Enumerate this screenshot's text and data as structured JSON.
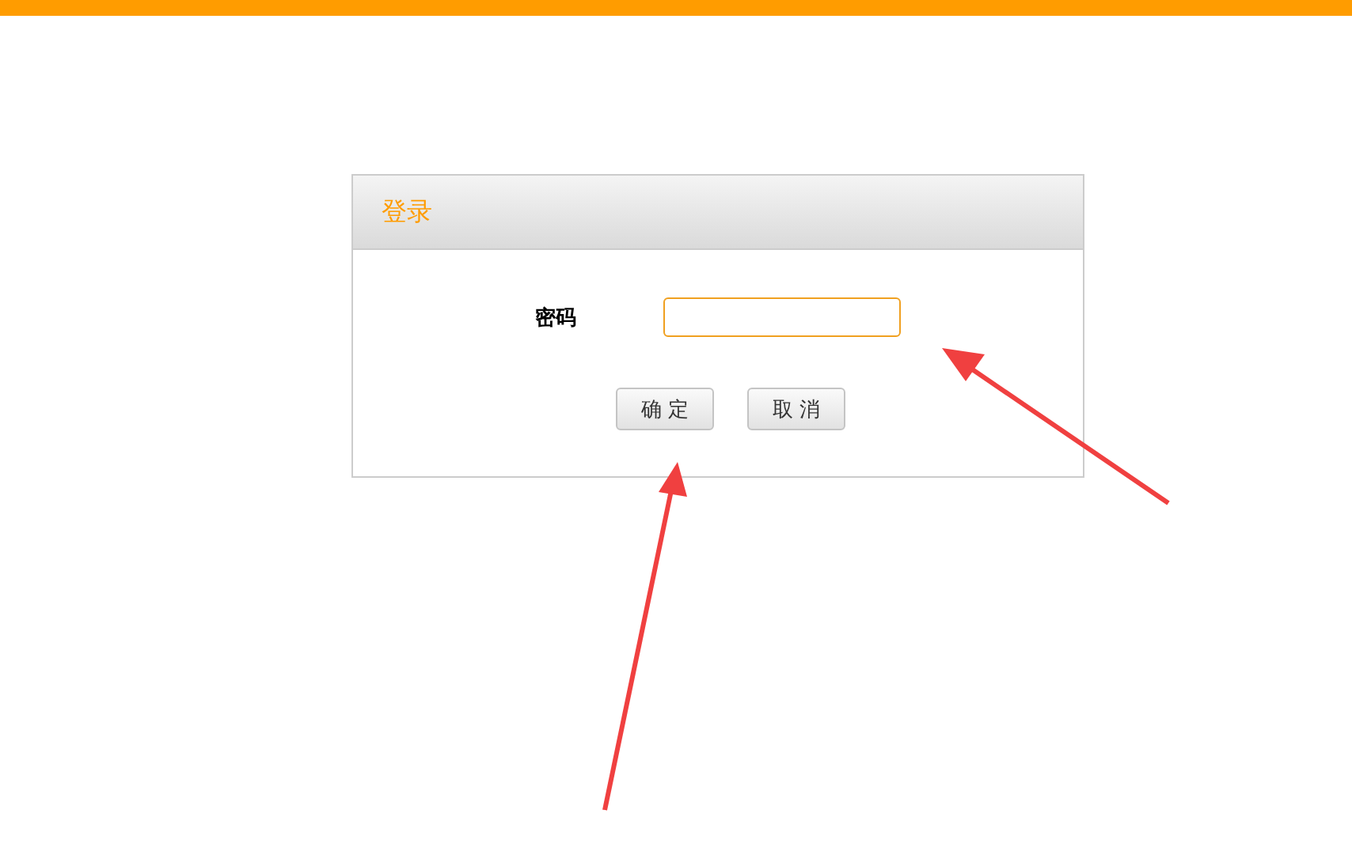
{
  "dialog": {
    "title": "登录",
    "password_label": "密码",
    "buttons": [
      "确 定",
      "取 消"
    ]
  }
}
